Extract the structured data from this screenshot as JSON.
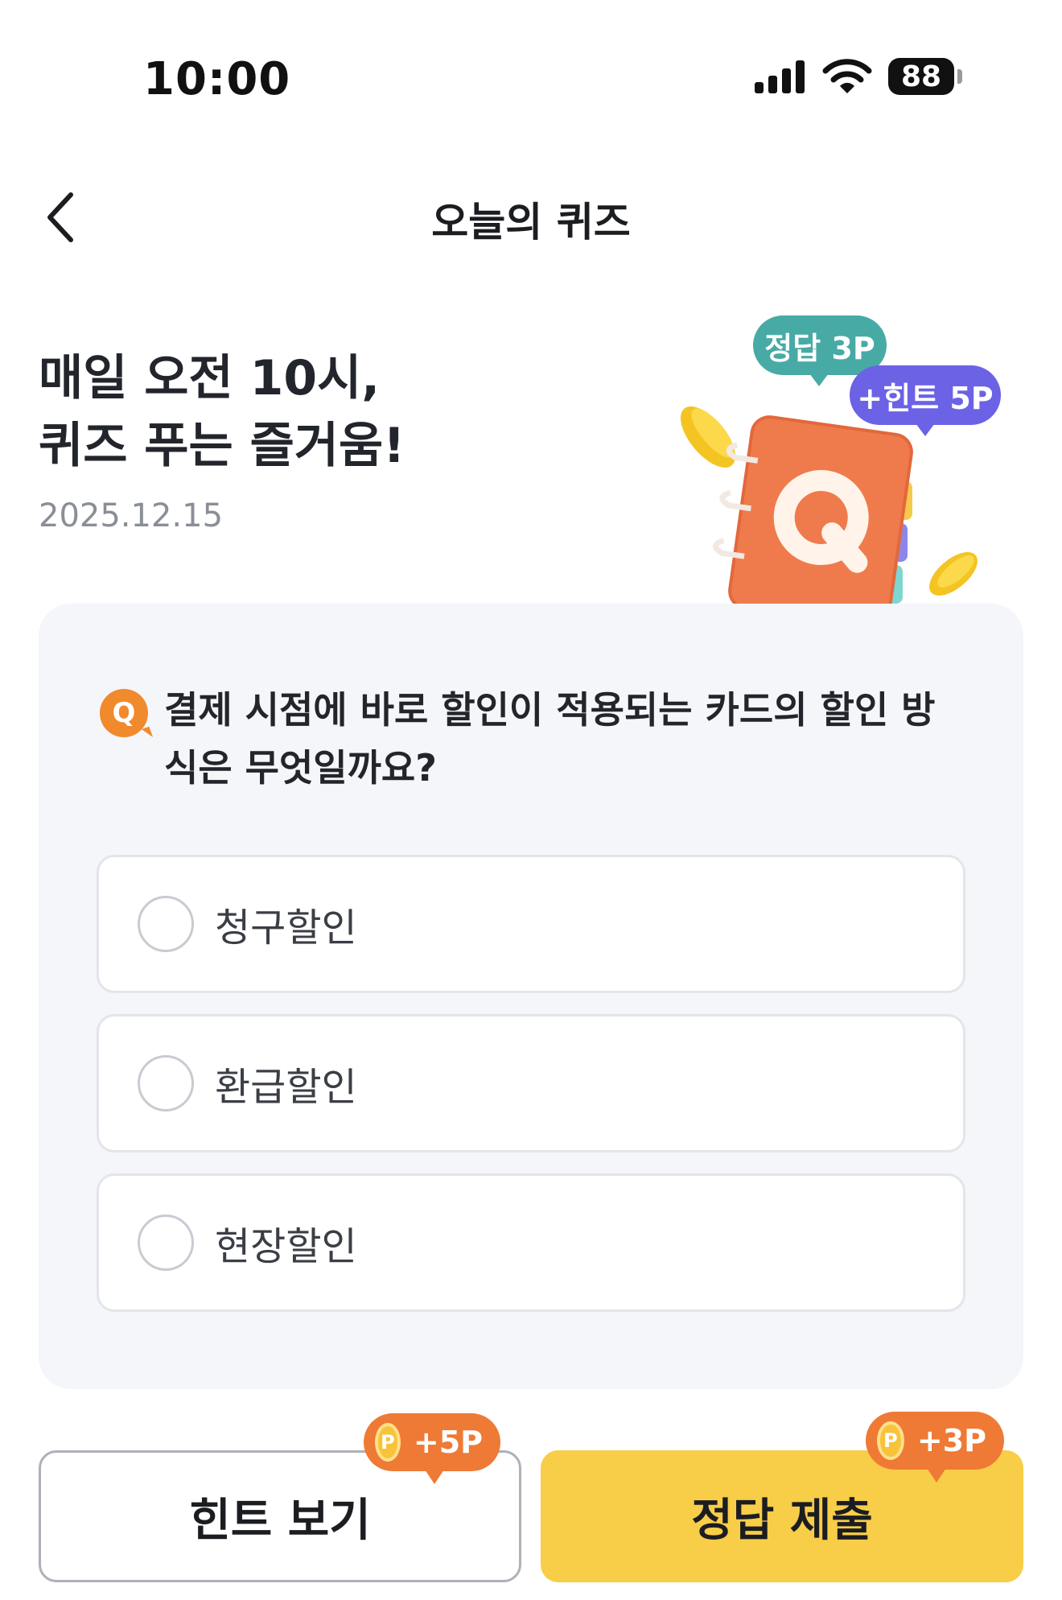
{
  "status_bar": {
    "time": "10:00",
    "battery": "88",
    "icons": [
      "cellular-signal-icon",
      "wifi-icon",
      "battery-icon"
    ]
  },
  "header": {
    "title": "오늘의 퀴즈",
    "back_icon": "chevron-left-icon"
  },
  "hero": {
    "title_line1": "매일 오전 10시,",
    "title_line2": "퀴즈 푸는 즐거움!",
    "date": "2025.12.15",
    "answer_bubble": "정답 3P",
    "hint_bubble": "+힌트 5P",
    "book_letter": "Q"
  },
  "quiz": {
    "badge": "Q",
    "question": "결제 시점에 바로 할인이 적용되는 카드의 할인 방식은 무엇일까요?",
    "options": [
      {
        "label": "청구할인"
      },
      {
        "label": "환급할인"
      },
      {
        "label": "현장할인"
      }
    ]
  },
  "actions": {
    "hint_label": "힌트 보기",
    "hint_reward": "+5P",
    "submit_label": "정답 제출",
    "submit_reward": "+3P",
    "coin_letter": "P"
  },
  "colors": {
    "accent_yellow": "#f8cd47",
    "reward_orange": "#ee7a35",
    "answer_teal": "#48aaa5",
    "hint_purple": "#6b62e6",
    "card_bg": "#f5f6fa"
  }
}
